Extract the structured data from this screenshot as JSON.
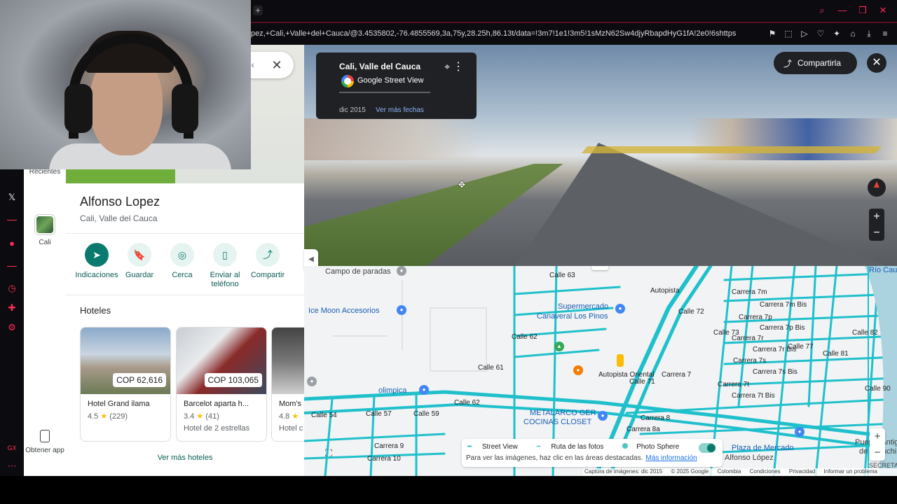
{
  "browser": {
    "new_tab": "+",
    "url": "pez,+Cali,+Valle+del+Cauca/@3.4535802,-76.4855569,3a,75y,28.25h,86.13t/data=!3m7!1e1!3m5!1sMzN62Sw4djyRbapdHyG1fA!2e0!6shttps"
  },
  "icons": {
    "search": "search-icon",
    "minimize": "minimize-icon",
    "restore": "restore-icon",
    "close": "close-icon",
    "bookmark": "bookmark-icon",
    "screenshot": "screenshot-icon",
    "play": "play-icon",
    "heart": "heart-icon",
    "extensions": "puzzle-icon",
    "account": "account-icon",
    "download": "download-icon",
    "menu": "menu-icon"
  },
  "maps_rail": {
    "recent_label": "Recientes",
    "recent_item_label": "Cali",
    "get_app_label": "Obtener app"
  },
  "place": {
    "title": "Alfonso Lopez",
    "subtitle": "Cali, Valle del Cauca",
    "actions": [
      {
        "label": "Indicaciones",
        "glyph": "➤"
      },
      {
        "label": "Guardar",
        "glyph": "🔖"
      },
      {
        "label": "Cerca",
        "glyph": "◎"
      },
      {
        "label": "Enviar al teléfono",
        "glyph": "▯"
      },
      {
        "label": "Compartir",
        "glyph": "⤴"
      }
    ],
    "hotels_title": "Hoteles",
    "hotels": [
      {
        "price": "COP 62,616",
        "name": "Hotel Grand ilama",
        "rating": "4.5",
        "reviews": "(229)",
        "class": ""
      },
      {
        "price": "COP 103,065",
        "name": "Barcelot aparta h...",
        "rating": "3.4",
        "reviews": "(41)",
        "class": "Hotel de 2 estrellas"
      },
      {
        "price": "",
        "name": "Mom's",
        "rating": "4.8",
        "reviews": "",
        "class": "Hotel c"
      }
    ],
    "more_hotels": "Ver más hoteles"
  },
  "streetview": {
    "location": "Cali, Valle del Cauca",
    "provider": "Google Street View",
    "date": "dic 2015",
    "more_dates": "Ver más fechas",
    "share": "Compartirla"
  },
  "map": {
    "labels": {
      "campo": "Campo de paradas",
      "ice_moon": "Ice Moon Accesorios",
      "supermercado": "Supermercado",
      "canaveral": "Canaveral Los Pinos",
      "olimpica": "olimpica",
      "metalarco": "METALARCO GER",
      "cocinas": "COCINAS CLOSET",
      "plaza": "Plaza de Mercado",
      "alfonso": "Alfonso López",
      "puente": "Puente Antigu",
      "juanchito": "de Juanchi",
      "rio_cauca": "Río Cauca",
      "secreta": "SECRETA",
      "autopista1": "Autopista",
      "autopista2": "Autopista Oriental",
      "carrera_7m": "Carrera 7m",
      "carrera_7m_bis": "Carrera 7m Bis",
      "carrera_7p": "Carrera 7p",
      "carrera_7p_bis": "Carrera 7p Bis",
      "carrera_7r": "Carrera 7r",
      "carrera_7r_bis": "Carrera 7r Bis",
      "carrera_7s": "Carrera 7s",
      "carrera_7s_bis": "Carrera 7s Bis",
      "carrera_7t": "Carrera 7t",
      "carrera_7t_bis": "Carrera 7t Bis",
      "carrera_7a": "Carrera 7",
      "carrera_8": "Carrera 8",
      "carrera_8a": "Carrera 8a",
      "carrera_9": "Carrera 9",
      "carrera_10": "Carrera 10",
      "calle_54": "Calle 54",
      "calle_57": "Calle 57",
      "calle_59": "Calle 59",
      "calle_61": "Calle 61",
      "calle_62": "Calle 62",
      "calle_62b": "Calle 62",
      "calle_63": "Calle 63",
      "calle_71": "Calle 71",
      "calle_72": "Calle 72",
      "calle_73": "Calle 73",
      "calle_77": "Calle 77",
      "calle_81": "Calle 81",
      "calle_82": "Calle 82",
      "calle_90": "Calle 90"
    },
    "legend": {
      "street_view": "Street View",
      "photo_route": "Ruta de las fotos",
      "photo_sphere": "Photo Sphere",
      "hint": "Para ver las imágenes, haz clic en las áreas destacadas.",
      "more_info": "Más información"
    },
    "attribution": [
      "Captura de imágenes: dic 2015",
      "© 2025 Google",
      "Colombia",
      "Condiciones",
      "Privacidad",
      "Informar un problema"
    ]
  },
  "colors": {
    "teal": "#0b7a6e",
    "sv_line": "#1fc0cc",
    "browser_accent": "#ff2d55"
  }
}
